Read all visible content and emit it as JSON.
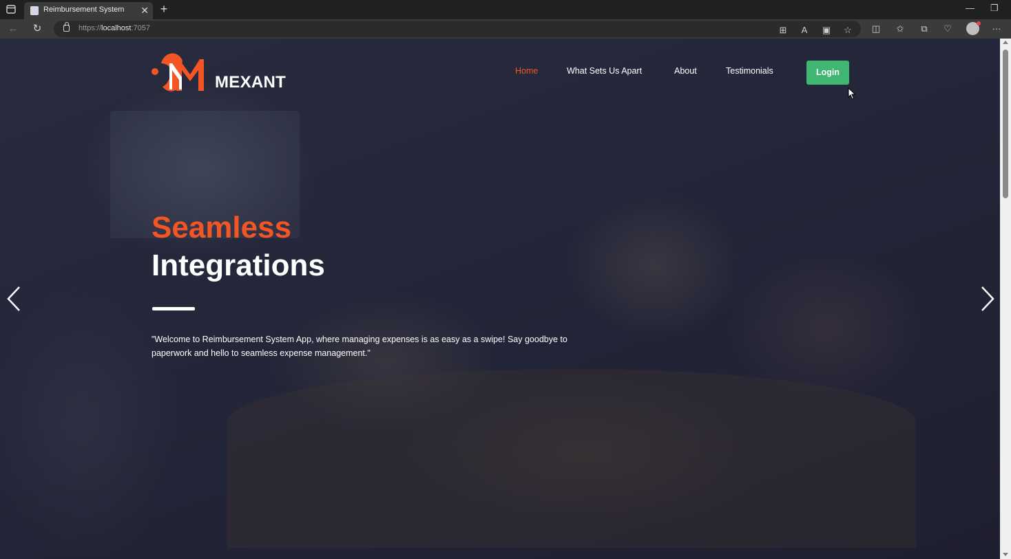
{
  "browser": {
    "tab_title": "Reimbursement System",
    "url_scheme": "https://",
    "url_host": "localhost",
    "url_port": ":7057"
  },
  "site": {
    "brand_name": "MEXANT",
    "nav": {
      "home": "Home",
      "what_sets_us_apart": "What Sets Us Apart",
      "about": "About",
      "testimonials": "Testimonials"
    },
    "login_label": "Login"
  },
  "hero": {
    "title_line1": "Seamless",
    "title_line2": "Integrations",
    "description": "\"Welcome to Reimbursement System App, where managing expenses is as easy as a swipe! Say goodbye to paperwork and hello to seamless expense management.\""
  },
  "colors": {
    "accent": "#f35525",
    "login_button": "#3fb772"
  },
  "icons": {
    "prev": "chevron-left-icon",
    "next": "chevron-right-icon"
  }
}
